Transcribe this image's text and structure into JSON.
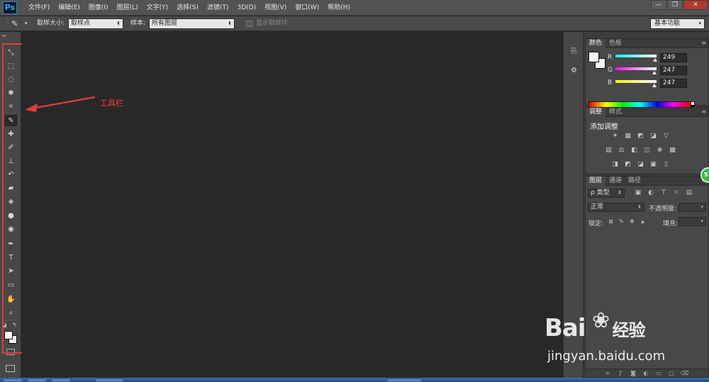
{
  "app": {
    "logo": "Ps"
  },
  "menu": [
    "文件(F)",
    "编辑(E)",
    "图像(I)",
    "图层(L)",
    "文字(Y)",
    "选择(S)",
    "滤镜(T)",
    "3D(D)",
    "视图(V)",
    "窗口(W)",
    "帮助(H)"
  ],
  "window_controls": {
    "minimize": "—",
    "restore": "❐",
    "close": "✕"
  },
  "options_bar": {
    "sample_size_label": "取样大小:",
    "sample_size_value": "取样点",
    "sample_label": "样本:",
    "sample_value": "所有图层",
    "show_ring_label": "显示取样环",
    "workspace": "基本功能"
  },
  "annotation": {
    "label": "工具栏"
  },
  "color_panel": {
    "tabs": [
      "颜色",
      "色板"
    ],
    "fg_color": "#f9f7f7",
    "channels": [
      {
        "label": "R",
        "value": "249"
      },
      {
        "label": "G",
        "value": "247"
      },
      {
        "label": "B",
        "value": "247"
      }
    ]
  },
  "adjustments_panel": {
    "tabs": [
      "调整",
      "样式"
    ],
    "title": "添加调整"
  },
  "layers_panel": {
    "tabs": [
      "图层",
      "通道",
      "路径"
    ],
    "filter_label": "ρ 类型",
    "blend_mode": "正常",
    "opacity_label": "不透明度:",
    "lock_label": "锁定:",
    "fill_label": "填充:"
  },
  "badge": {
    "value": "57"
  },
  "watermark": {
    "logo": "Bai",
    "logo_suffix": "经验",
    "url": "jingyan.baidu.com"
  }
}
